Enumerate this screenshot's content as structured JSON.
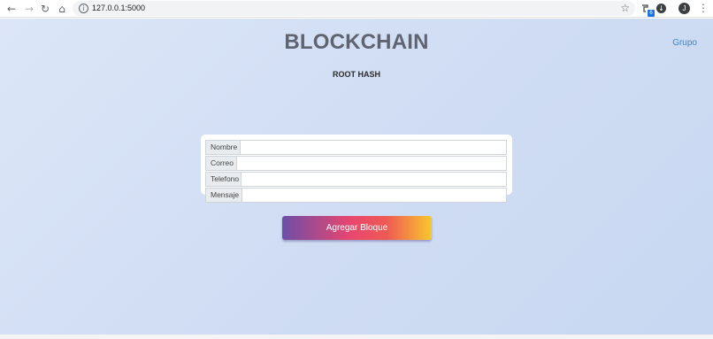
{
  "browser": {
    "url": "127.0.0.1:5000",
    "icons": [
      "back-arrow-icon",
      "forward-arrow-icon",
      "reload-icon",
      "home-icon",
      "info-icon",
      "star-icon",
      "extension-icon",
      "download-icon",
      "avatar",
      "menu-icon"
    ],
    "extension_badge": "6",
    "avatar_initial": "J"
  },
  "page": {
    "title": "BLOCKCHAIN",
    "subtitle": "ROOT HASH",
    "group_link": "Grupo"
  },
  "form": {
    "fields": [
      {
        "label": "Nombre",
        "value": ""
      },
      {
        "label": "Correo",
        "value": ""
      },
      {
        "label": "Telefono",
        "value": ""
      },
      {
        "label": "Mensaje",
        "value": ""
      }
    ],
    "submit_label": "Agregar Bloque"
  },
  "colors": {
    "background": "#cfdcf3",
    "title": "#5f6470",
    "link": "#3a86d4",
    "button_gradient": [
      "#6c4ea8",
      "#e8466f",
      "#ee5a53",
      "#f9c82d"
    ]
  }
}
